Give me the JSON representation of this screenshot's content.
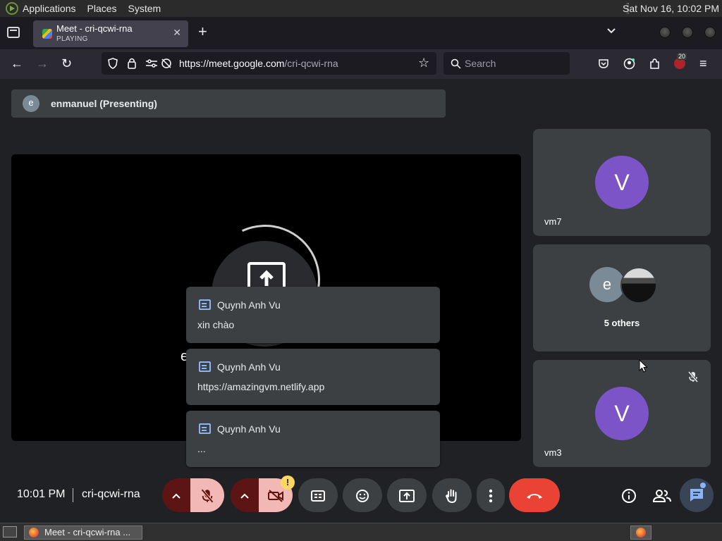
{
  "os_panel": {
    "menus": [
      "Applications",
      "Places",
      "System"
    ],
    "clock": "Sat Nov 16, 10:02 PM"
  },
  "browser": {
    "tab": {
      "title": "Meet - cri-qcwi-rna",
      "status": "PLAYING"
    },
    "url_host": "https://meet.google.com",
    "url_path": "/cri-qcwi-rna",
    "search_placeholder": "Search",
    "extension_badge": "20"
  },
  "meet": {
    "presenter": {
      "initial": "e",
      "label": "enmanuel (Presenting)"
    },
    "stage_letter": "e",
    "tiles": [
      {
        "initial": "V",
        "name": "vm7"
      },
      {
        "initial": "e",
        "others_label": "5 others"
      },
      {
        "initial": "V",
        "name": "vm3"
      }
    ],
    "chat_notifications": [
      {
        "sender": "Quynh Anh Vu",
        "message": "xin chào"
      },
      {
        "sender": "Quynh Anh Vu",
        "message": "https://amazingvm.netlify.app"
      },
      {
        "sender": "Quynh Anh Vu",
        "message": "..."
      }
    ],
    "meeting_time": "10:01 PM",
    "meeting_code": "cri-qcwi-rna",
    "camera_warning": "!"
  },
  "taskbar": {
    "window_label": "Meet - cri-qcwi-rna ..."
  },
  "colors": {
    "avatar_purple": "#7c54c8",
    "end_call_red": "#ea4335",
    "accent_blue": "#8ab4f8",
    "mute_pink": "#f2b8b5"
  }
}
